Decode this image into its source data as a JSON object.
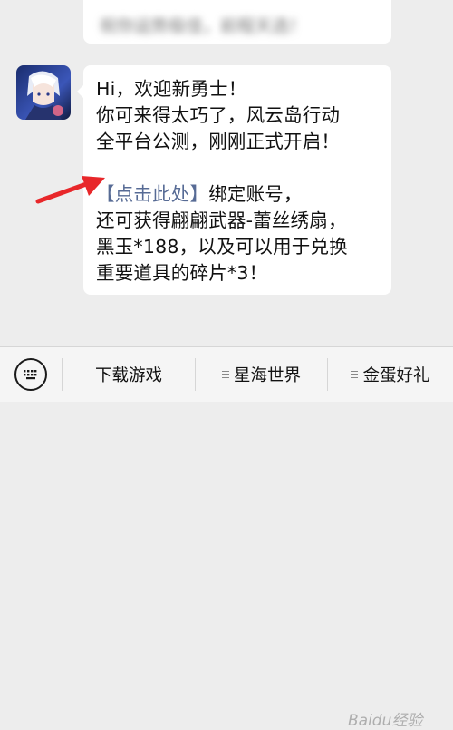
{
  "chat": {
    "previous_message": "祝你运势极佳，前程天选！",
    "message": {
      "line1": "Hi，欢迎新勇士！",
      "line2": "你可来得太巧了，风云岛行动",
      "line3": "全平台公测，刚刚正式开启！",
      "link_text": "【点击此处】",
      "line4_rest": "绑定账号，",
      "line5": "还可获得翩翩武器-蕾丝绣扇，",
      "line6": "黑玉*188，以及可以用于兑换",
      "line7": "重要道具的碎片*3！"
    },
    "annotation": {
      "arrow_color": "#e8272a"
    }
  },
  "menu": {
    "items": [
      {
        "label": "下载游戏"
      },
      {
        "label": "星海世界"
      },
      {
        "label": "金蛋好礼"
      }
    ]
  },
  "watermark": "Baidu经验",
  "colors": {
    "link": "#576b95",
    "background": "#ededed",
    "bubble": "#ffffff"
  }
}
